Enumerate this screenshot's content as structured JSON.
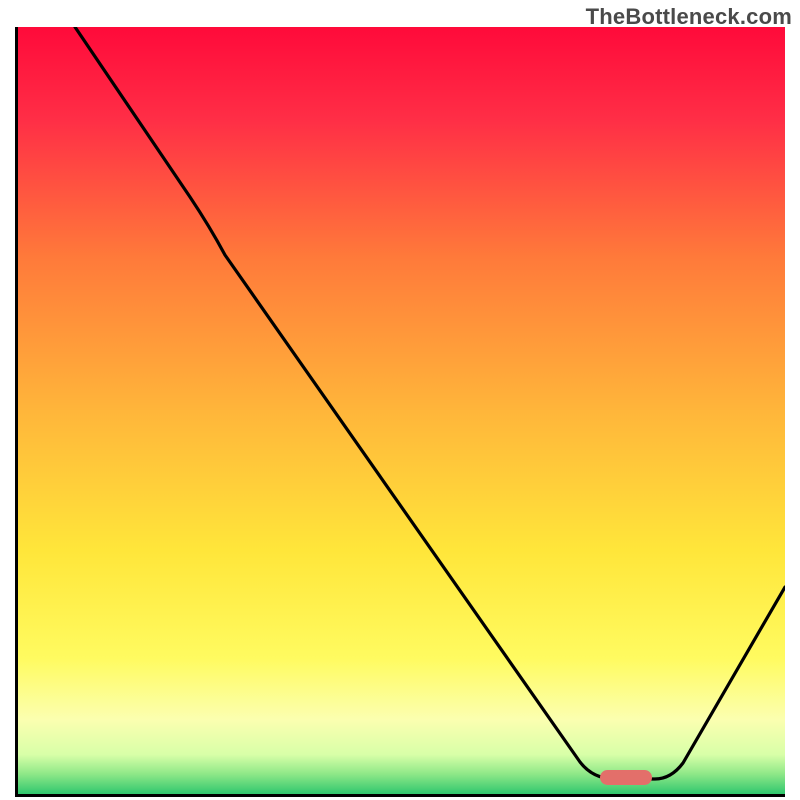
{
  "watermark": "TheBottleneck.com",
  "chart_data": {
    "type": "line",
    "title": "",
    "xlabel": "",
    "ylabel": "",
    "xlim": [
      0,
      100
    ],
    "ylim": [
      0,
      100
    ],
    "x": [
      8,
      23,
      27,
      73,
      78,
      83,
      87,
      100
    ],
    "values": [
      100,
      78,
      70,
      3.5,
      2.3,
      2.3,
      4,
      27
    ],
    "gradient_stops": [
      {
        "pos": 0.0,
        "color": "#ff0a3a"
      },
      {
        "pos": 0.12,
        "color": "#ff2e46"
      },
      {
        "pos": 0.3,
        "color": "#ff7a3a"
      },
      {
        "pos": 0.5,
        "color": "#ffb63a"
      },
      {
        "pos": 0.68,
        "color": "#ffe63a"
      },
      {
        "pos": 0.82,
        "color": "#fffb60"
      },
      {
        "pos": 0.9,
        "color": "#fbffb0"
      },
      {
        "pos": 0.945,
        "color": "#d8ffa8"
      },
      {
        "pos": 0.97,
        "color": "#8fe888"
      },
      {
        "pos": 1.0,
        "color": "#22c26a"
      }
    ],
    "marker": {
      "x_center_pct": 79,
      "y_from_bottom_pct": 2.5,
      "color": "#e36f6a",
      "style": "left:585px; bottom:12px; background:#e36f6a;"
    },
    "annotations": []
  }
}
